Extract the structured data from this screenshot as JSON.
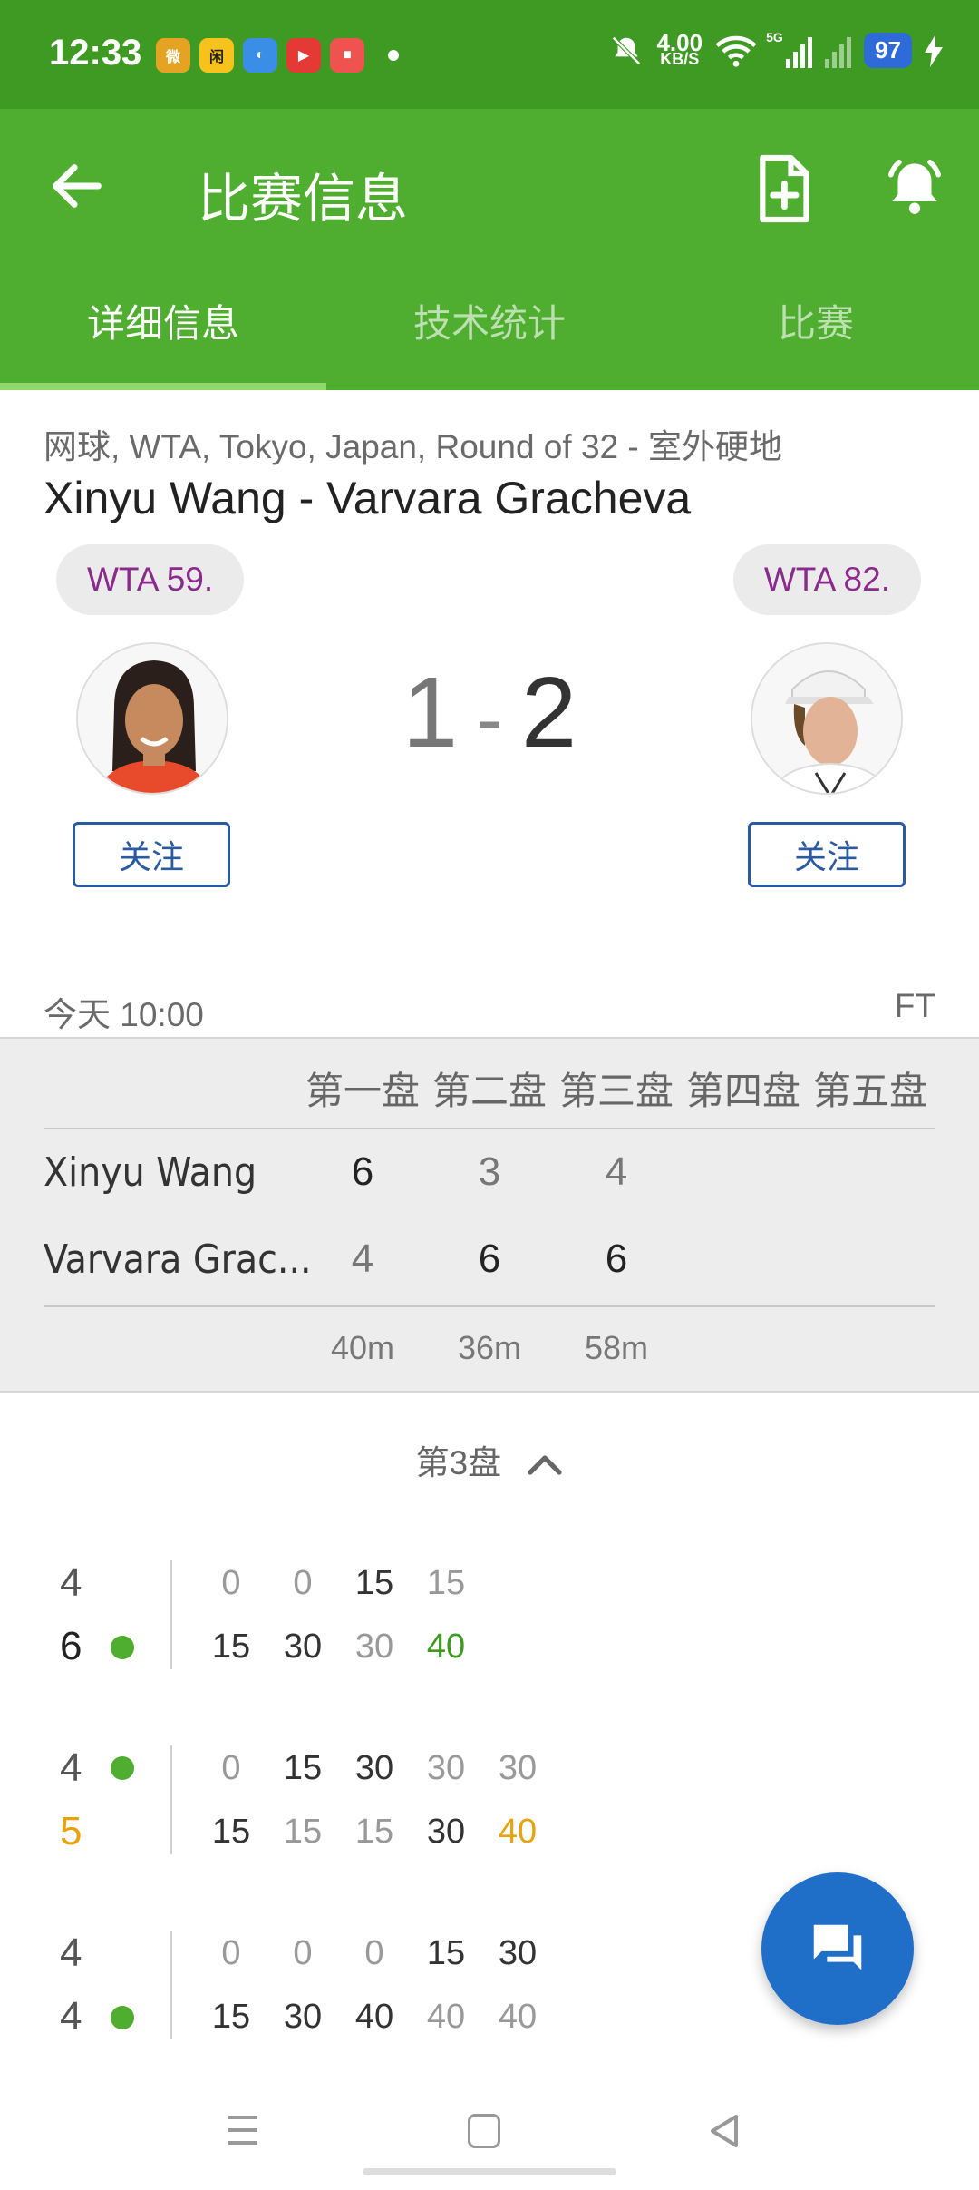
{
  "status_bar": {
    "time": "12:33",
    "net_speed_value": "4.00",
    "net_speed_unit": "KB/S",
    "signal_label": "5G",
    "battery": "97",
    "notif_apps": [
      {
        "name": "weibo",
        "color": "#e5a323",
        "glyph": "微"
      },
      {
        "name": "app2",
        "color": "#f6c21b",
        "glyph": "闲"
      },
      {
        "name": "app3",
        "color": "#3a8ee6",
        "glyph": "◐"
      },
      {
        "name": "app4",
        "color": "#e53935",
        "glyph": "▶"
      },
      {
        "name": "app5",
        "color": "#ef5350",
        "glyph": "■"
      }
    ]
  },
  "app_bar": {
    "title": "比赛信息",
    "tabs": [
      {
        "label": "详细信息",
        "active": true
      },
      {
        "label": "技术统计",
        "active": false
      },
      {
        "label": "比赛",
        "active": false
      }
    ]
  },
  "match": {
    "meta": "网球, WTA, Tokyo, Japan, Round of 32 - 室外硬地",
    "title": "Xinyu Wang - Varvara Gracheva",
    "home_rank": "WTA 59.",
    "away_rank": "WTA 82.",
    "home_score": "1",
    "separator": "-",
    "away_score": "2",
    "follow_label": "关注",
    "time": "今天 10:00",
    "status": "FT"
  },
  "set_table": {
    "headers": [
      "第一盘",
      "第二盘",
      "第三盘",
      "第四盘",
      "第五盘"
    ],
    "players": [
      {
        "name": "Xinyu Wang",
        "sets": [
          "6",
          "3",
          "4"
        ]
      },
      {
        "name": "Varvara Grac...",
        "sets": [
          "4",
          "6",
          "6"
        ]
      }
    ],
    "durations": [
      "40m",
      "36m",
      "58m"
    ]
  },
  "set_section": {
    "label": "第3盘"
  },
  "games": [
    {
      "top_score": "4",
      "bottom_score": "6",
      "server": "bottom",
      "top_points": [
        "0",
        "0",
        "15",
        "15"
      ],
      "bottom_points": [
        "15",
        "30",
        "30",
        "40"
      ]
    },
    {
      "top_score": "4",
      "bottom_score": "5",
      "server": "top",
      "top_points": [
        "0",
        "15",
        "30",
        "30",
        "30"
      ],
      "bottom_points": [
        "15",
        "15",
        "15",
        "30",
        "40"
      ]
    },
    {
      "top_score": "4",
      "bottom_score": "4",
      "server": "bottom",
      "top_points": [
        "0",
        "0",
        "0",
        "15",
        "30"
      ],
      "bottom_points": [
        "15",
        "30",
        "40",
        "40",
        "40"
      ]
    }
  ],
  "colors": {
    "status_bar": "#3f9a23",
    "app_bar": "#4fad2f",
    "rank_text": "#8a2a8c",
    "follow_border": "#2a5aa0",
    "fab": "#1f6fc8",
    "break_point": "#e9a20b",
    "game_point": "#3f9a23"
  }
}
